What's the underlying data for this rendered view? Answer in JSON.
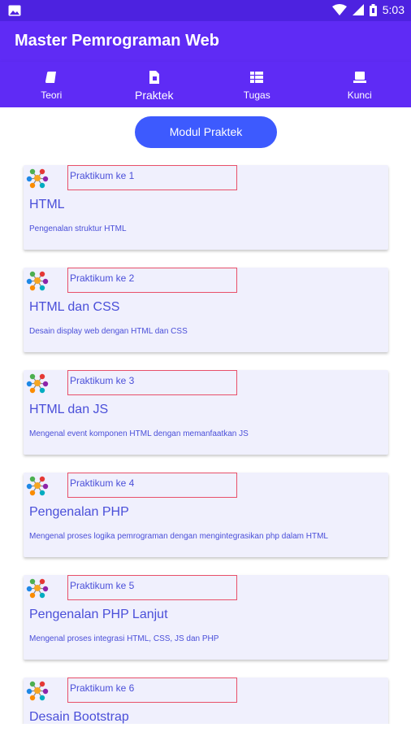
{
  "status_bar": {
    "time": "5:03",
    "icons": [
      "image-icon",
      "wifi-icon",
      "signal-icon",
      "battery-icon"
    ]
  },
  "app_bar": {
    "title": "Master Pemrograman Web"
  },
  "tabs": [
    {
      "label": "Teori",
      "icon": "book-icon",
      "active": false
    },
    {
      "label": "Praktek",
      "icon": "document-icon",
      "active": true
    },
    {
      "label": "Tugas",
      "icon": "grid-icon",
      "active": false
    },
    {
      "label": "Kunci",
      "icon": "key-icon",
      "active": false
    }
  ],
  "modul_button": {
    "label": "Modul Praktek"
  },
  "cards": [
    {
      "praktikum": "Praktikum ke 1",
      "title": "HTML",
      "description": "Pengenalan struktur HTML"
    },
    {
      "praktikum": "Praktikum ke 2",
      "title": "HTML dan CSS",
      "description": "Desain display web dengan HTML dan CSS"
    },
    {
      "praktikum": "Praktikum ke 3",
      "title": "HTML dan JS",
      "description": "Mengenal event komponen HTML dengan memanfaatkan JS"
    },
    {
      "praktikum": "Praktikum ke 4",
      "title": "Pengenalan PHP",
      "description": "Mengenal proses logika pemrograman dengan mengintegrasikan php dalam HTML"
    },
    {
      "praktikum": "Praktikum ke 5",
      "title": "Pengenalan PHP Lanjut",
      "description": "Mengenal proses integrasi HTML, CSS, JS dan PHP"
    },
    {
      "praktikum": "Praktikum ke 6",
      "title": "Desain Bootstrap",
      "description": ""
    }
  ],
  "colors": {
    "status_bar": "#4d22e0",
    "app_bar": "#5f2bf5",
    "button": "#3d5afe",
    "card_bg": "#f0f0fd",
    "card_text": "#4a4fd9",
    "label_border": "#e8506a"
  }
}
